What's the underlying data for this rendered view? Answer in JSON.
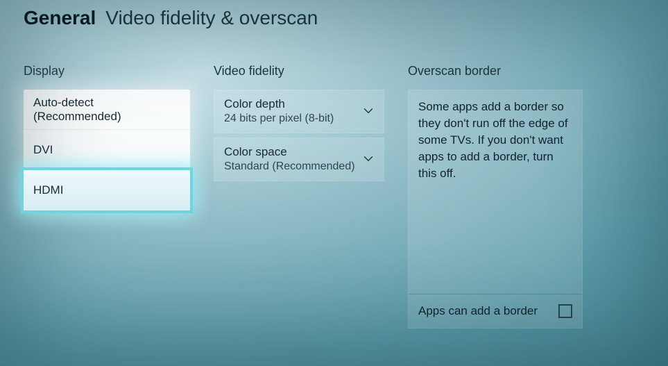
{
  "header": {
    "crumb": "General",
    "title": "Video fidelity & overscan"
  },
  "display": {
    "label": "Display",
    "items": [
      {
        "label": "Auto-detect (Recommended)"
      },
      {
        "label": "DVI"
      },
      {
        "label": "HDMI"
      }
    ],
    "focused_index": 2
  },
  "video_fidelity": {
    "label": "Video fidelity",
    "color_depth": {
      "label": "Color depth",
      "value": "24 bits per pixel (8-bit)"
    },
    "color_space": {
      "label": "Color space",
      "value": "Standard (Recommended)"
    }
  },
  "overscan": {
    "label": "Overscan border",
    "description": "Some apps add a border so they don't run off the edge of some TVs. If you don't want apps to add a border, turn this off.",
    "toggle_label": "Apps can add a border",
    "toggle_checked": false
  }
}
